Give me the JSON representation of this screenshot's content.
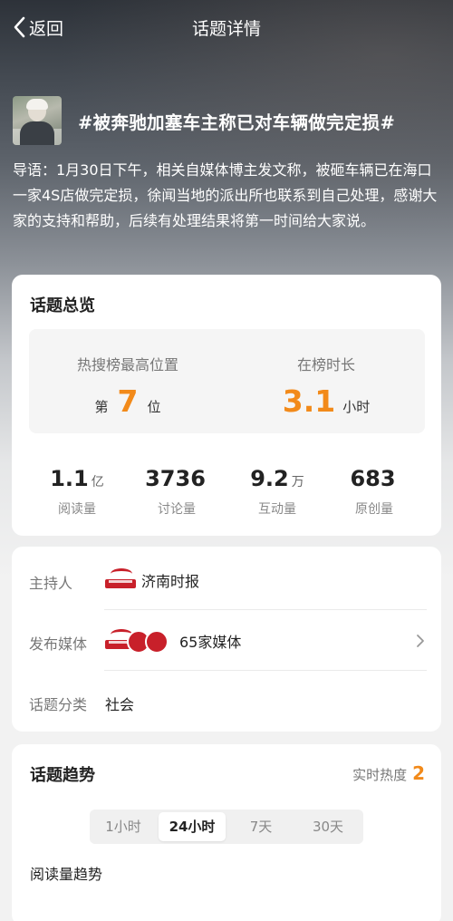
{
  "nav": {
    "back_label": "返回",
    "title": "话题详情"
  },
  "topic": {
    "title": "#被奔驰加塞车主称已对车辆做完定损#",
    "intro": "导语：1月30日下午，相关自媒体博主发文称，被砸车辆已在海口一家4S店做完定损，徐闻当地的派出所也联系到自己处理，感谢大家的支持和帮助，后续有处理结果将第一时间给大家说。"
  },
  "overview": {
    "title": "话题总览",
    "rank_label": "热搜榜最高位置",
    "rank_prefix": "第",
    "rank_value": "7",
    "rank_suffix": "位",
    "duration_label": "在榜时长",
    "duration_value": "3.1",
    "duration_unit": "小时",
    "stats": [
      {
        "value": "1.1",
        "unit": "亿",
        "label": "阅读量"
      },
      {
        "value": "3736",
        "unit": "",
        "label": "讨论量"
      },
      {
        "value": "9.2",
        "unit": "万",
        "label": "互动量"
      },
      {
        "value": "683",
        "unit": "",
        "label": "原创量"
      }
    ]
  },
  "info": {
    "host_label": "主持人",
    "host_value": "济南时报",
    "media_label": "发布媒体",
    "media_value": "65家媒体",
    "category_label": "话题分类",
    "category_value": "社会"
  },
  "trend": {
    "title": "话题趋势",
    "hot_label": "实时热度",
    "hot_value": "2",
    "tabs": [
      "1小时",
      "24小时",
      "7天",
      "30天"
    ],
    "active_tab": "24小时",
    "sub_label": "阅读量趋势"
  },
  "colors": {
    "accent": "#f28a1a",
    "brand_red": "#c8202a"
  }
}
